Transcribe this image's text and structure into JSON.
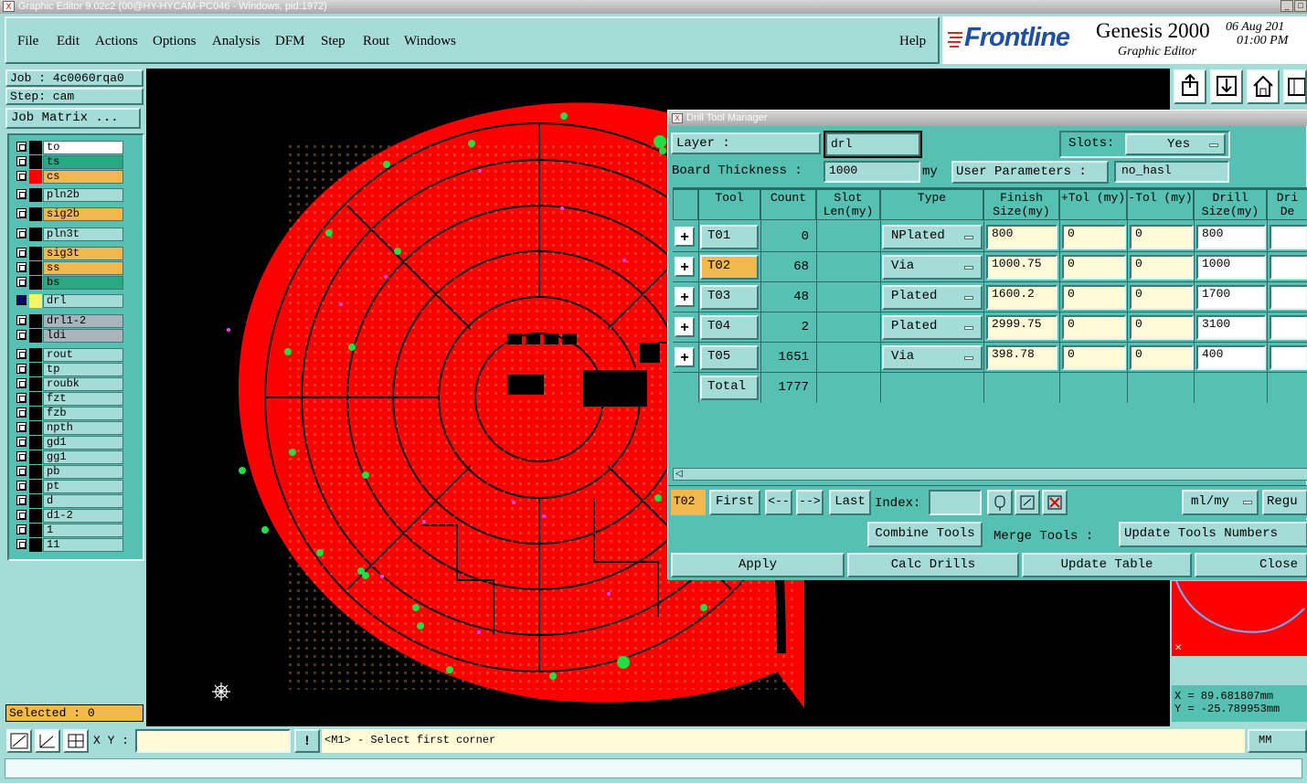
{
  "window": {
    "title": "Graphic Editor 9.02c2 (00@HY-HYCAM-PC046 - Windows, pid:1972)"
  },
  "menu": {
    "items": [
      "File",
      "Edit",
      "Actions",
      "Options",
      "Analysis",
      "DFM",
      "Step",
      "Rout",
      "Windows"
    ],
    "help": "Help"
  },
  "brand": {
    "company": "Frontline",
    "product": "Genesis 2000",
    "subtitle": "Graphic Editor",
    "date": "06 Aug 201",
    "time": "01:00 PM"
  },
  "job": {
    "job_label": "Job : 4c0060rqa0",
    "step_label": "Step: cam",
    "matrix_button": "Job Matrix ..."
  },
  "layers": [
    {
      "name": "to",
      "color": "#ffffff",
      "swatch": "#000000"
    },
    {
      "name": "ts",
      "color": "#2aa882",
      "swatch": "#000000"
    },
    {
      "name": "cs",
      "color": "#f2b84b",
      "swatch": "#ff0000"
    },
    {
      "name": "pln2b",
      "color": "#a6dcd8",
      "swatch": "#000000"
    },
    {
      "name": "sig2b",
      "color": "#f2b84b",
      "swatch": "#000000"
    },
    {
      "name": "pln3t",
      "color": "#a6dcd8",
      "swatch": "#000000"
    },
    {
      "name": "sig3t",
      "color": "#f2b84b",
      "swatch": "#000000"
    },
    {
      "name": "ss",
      "color": "#f2b84b",
      "swatch": "#000000"
    },
    {
      "name": "bs",
      "color": "#2aa882",
      "swatch": "#000000"
    },
    {
      "name": "drl",
      "color": "#a6dcd8",
      "swatch": "#f5f56a"
    },
    {
      "name": "drl1-2",
      "color": "#a9b4bc",
      "swatch": "#000000"
    },
    {
      "name": "ldi",
      "color": "#a9b4bc",
      "swatch": "#000000"
    },
    {
      "name": "rout",
      "color": "#a6dcd8",
      "swatch": "#000000"
    },
    {
      "name": "tp",
      "color": "#a6dcd8",
      "swatch": "#000000"
    },
    {
      "name": "roubk",
      "color": "#a6dcd8",
      "swatch": "#000000"
    },
    {
      "name": "fzt",
      "color": "#a6dcd8",
      "swatch": "#000000"
    },
    {
      "name": "fzb",
      "color": "#a6dcd8",
      "swatch": "#000000"
    },
    {
      "name": "npth",
      "color": "#a6dcd8",
      "swatch": "#000000"
    },
    {
      "name": "gd1",
      "color": "#a6dcd8",
      "swatch": "#000000"
    },
    {
      "name": "gg1",
      "color": "#a6dcd8",
      "swatch": "#000000"
    },
    {
      "name": "pb",
      "color": "#a6dcd8",
      "swatch": "#000000"
    },
    {
      "name": "pt",
      "color": "#a6dcd8",
      "swatch": "#000000"
    },
    {
      "name": "d",
      "color": "#a6dcd8",
      "swatch": "#000000"
    },
    {
      "name": "d1-2",
      "color": "#a6dcd8",
      "swatch": "#000000"
    },
    {
      "name": "1",
      "color": "#a6dcd8",
      "swatch": "#000000"
    },
    {
      "name": "11",
      "color": "#a6dcd8",
      "swatch": "#000000"
    }
  ],
  "selected": "Selected : 0",
  "bottom": {
    "xy_label": "X Y :",
    "xy_value": "",
    "prompt": "<M1> - Select first corner",
    "units": "MM"
  },
  "coords": {
    "x": "X = 89.681807mm",
    "y": "Y = -25.789953mm"
  },
  "dtm": {
    "title": "Drill Tool Manager",
    "layer_label": "Layer :",
    "layer_value": "drl",
    "slots_label": "Slots:",
    "slots_value": "Yes",
    "thickness_label": "Board Thickness :",
    "thickness_value": "1000",
    "thickness_unit": "my",
    "user_params_label": "User Parameters :",
    "user_params_value": "no_hasl",
    "headers": [
      "Tool",
      "Count",
      "Slot Len(my)",
      "Type",
      "Finish Size(my)",
      "+Tol (my)",
      "-Tol (my)",
      "Drill Size(my)",
      "Dri De"
    ],
    "rows": [
      {
        "tool": "T01",
        "count": "0",
        "type": "NPlated",
        "finish": "800",
        "ptol": "0",
        "ntol": "0",
        "drill": "800"
      },
      {
        "tool": "T02",
        "count": "68",
        "type": "Via",
        "finish": "1000.75",
        "ptol": "0",
        "ntol": "0",
        "drill": "1000"
      },
      {
        "tool": "T03",
        "count": "48",
        "type": "Plated",
        "finish": "1600.2",
        "ptol": "0",
        "ntol": "0",
        "drill": "1700"
      },
      {
        "tool": "T04",
        "count": "2",
        "type": "Plated",
        "finish": "2999.75",
        "ptol": "0",
        "ntol": "0",
        "drill": "3100"
      },
      {
        "tool": "T05",
        "count": "1651",
        "type": "Via",
        "finish": "398.78",
        "ptol": "0",
        "ntol": "0",
        "drill": "400"
      }
    ],
    "total_label": "Total",
    "total_count": "1777",
    "current_tool": "T02",
    "nav": {
      "first": "First",
      "prev": "<--",
      "next": "-->",
      "last": "Last",
      "index_label": "Index:",
      "units": "ml/my",
      "regu": "Regu"
    },
    "actions": {
      "combine": "Combine Tools",
      "merge": "Merge Tools :",
      "update_numbers": "Update Tools Numbers"
    },
    "buttons": {
      "apply": "Apply",
      "calc": "Calc Drills",
      "update": "Update Table",
      "close": "Close"
    }
  }
}
